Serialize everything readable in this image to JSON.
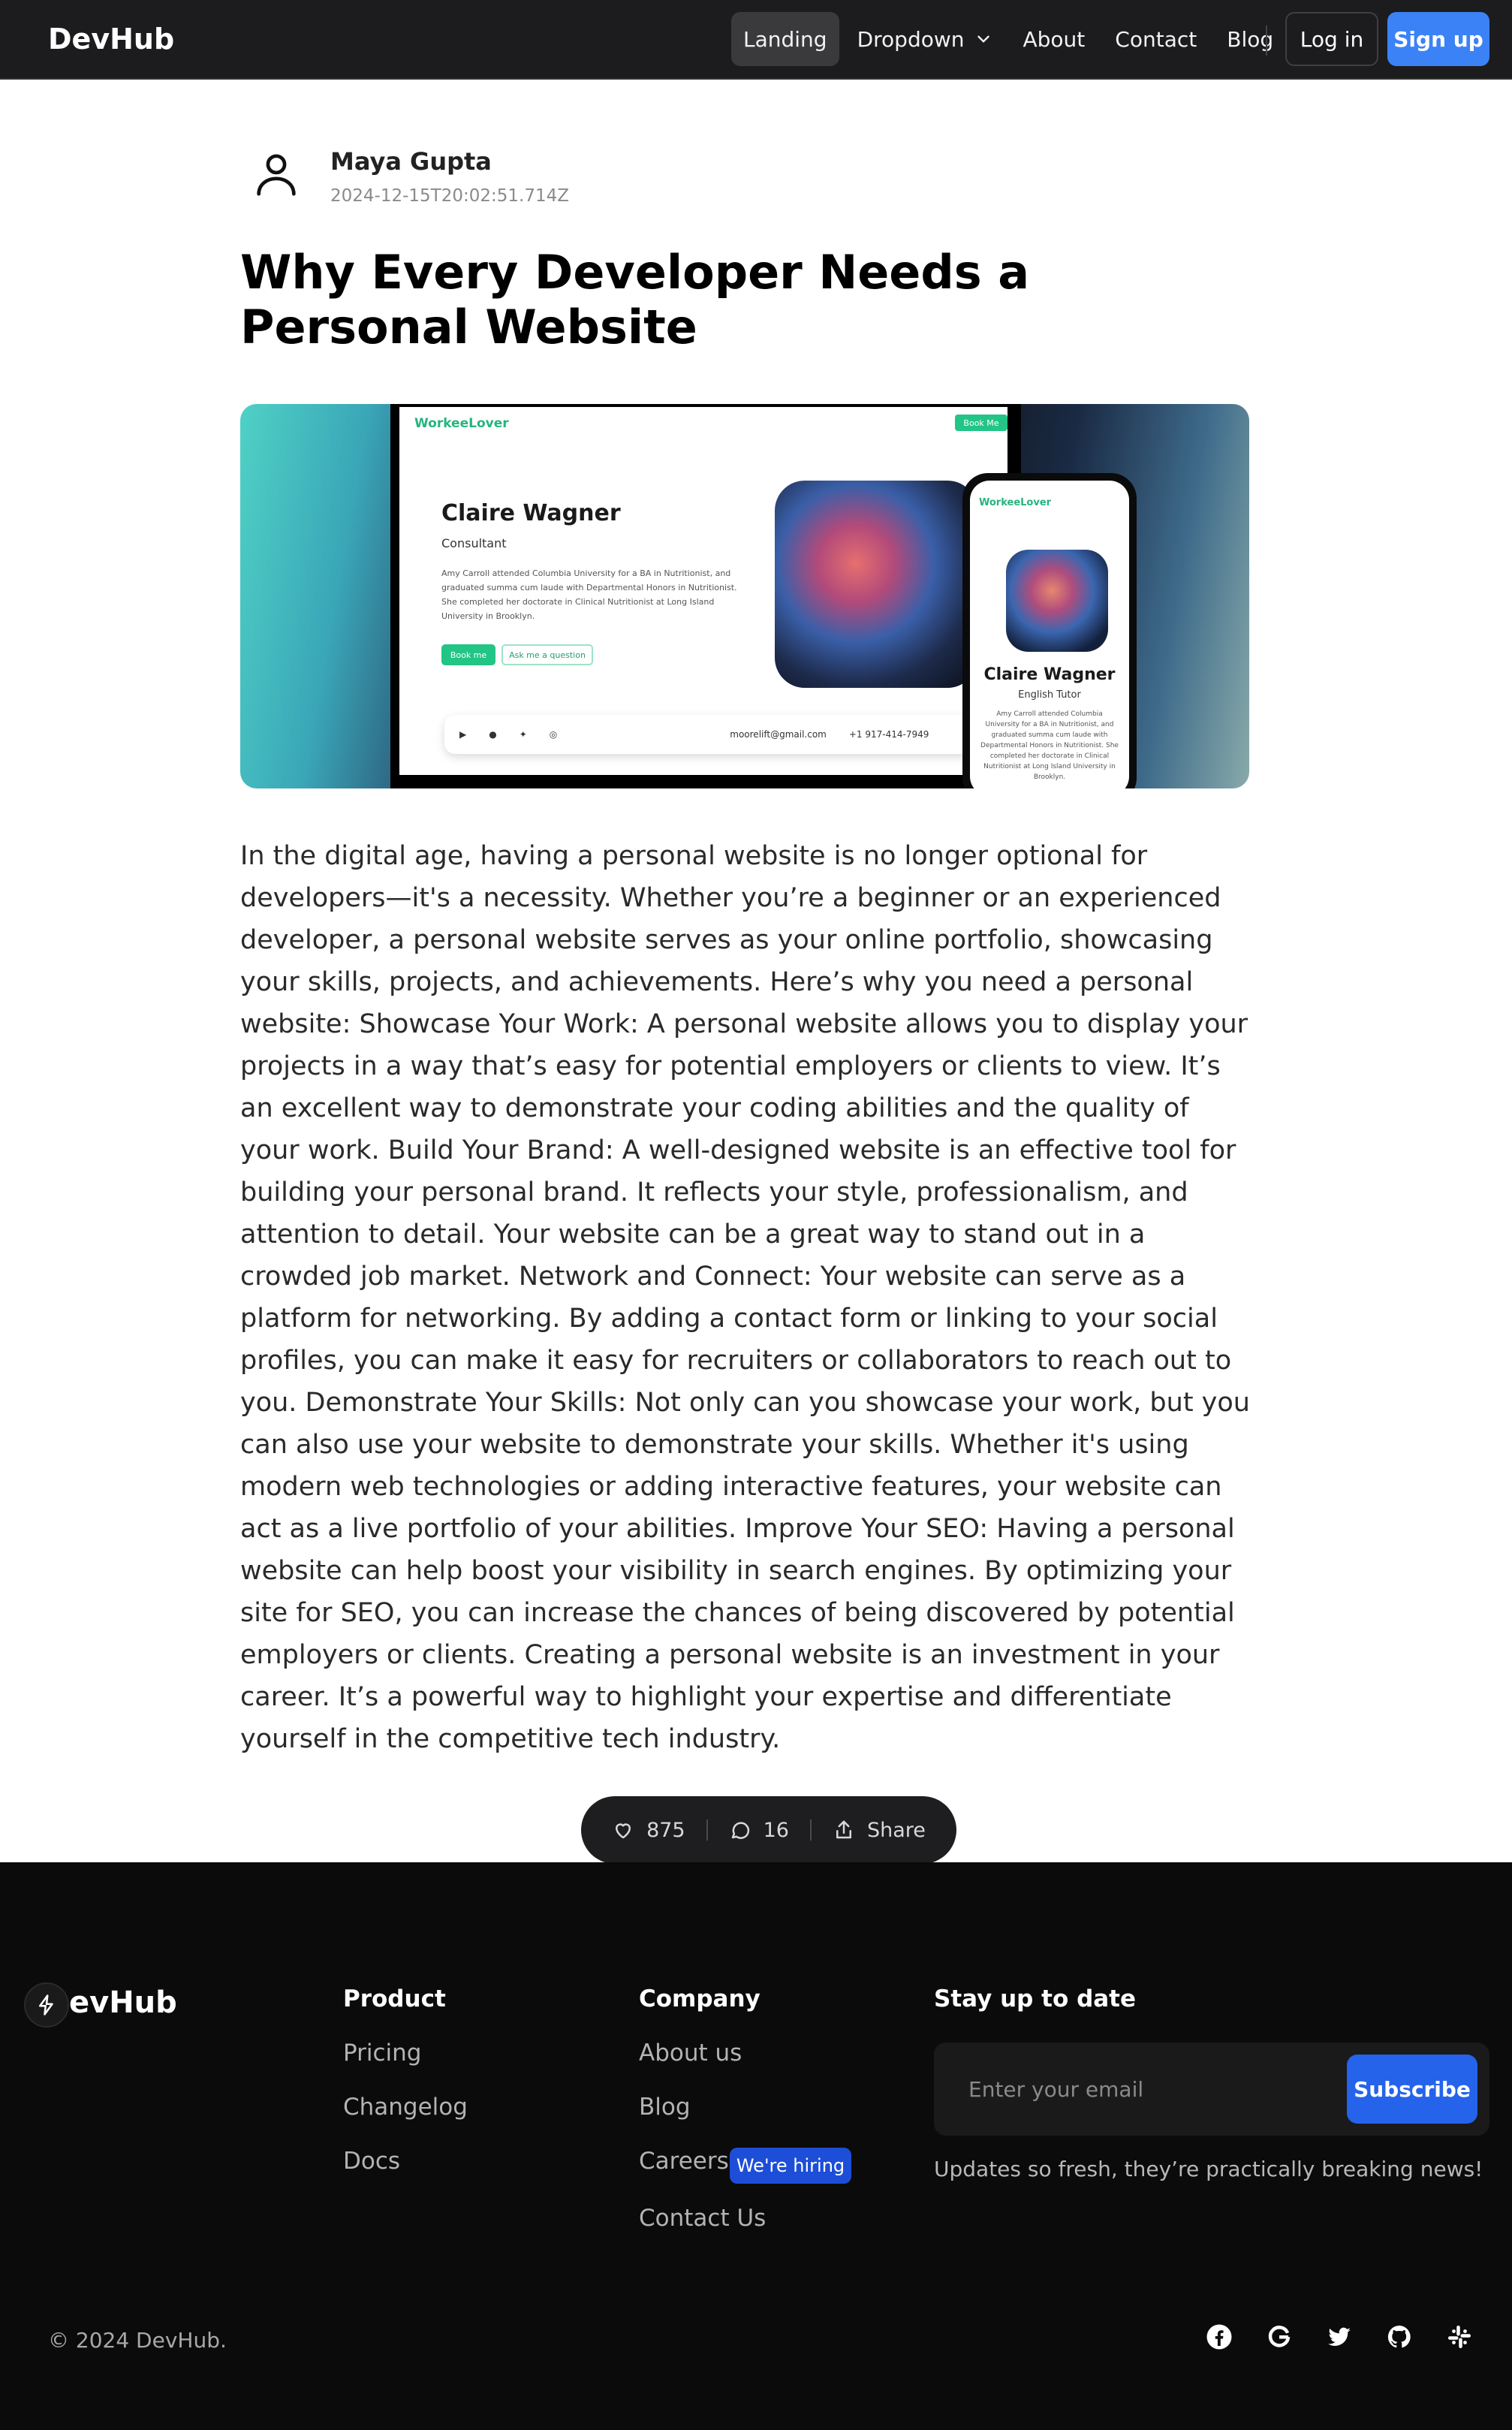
{
  "nav": {
    "brand": "DevHub",
    "links": [
      "Landing",
      "Dropdown",
      "About",
      "Contact",
      "Blog"
    ],
    "login": "Log in",
    "signup": "Sign up"
  },
  "post": {
    "author": "Maya Gupta",
    "date": "2024-12-15T20:02:51.714Z",
    "title": "Why Every Developer Needs a Personal Website",
    "hero": {
      "logo": "WorkeeLover",
      "book_me": "Book Me",
      "name": "Claire Wagner",
      "role": "Consultant",
      "bio": "Amy Carroll attended Columbia University for a BA in Nutritionist, and graduated summa cum laude with Departmental Honors in Nutritionist. She completed her doctorate in Clinical Nutritionist at Long Island University in Brooklyn.",
      "btn_book": "Book me",
      "btn_ask": "Ask me a question",
      "email": "moorelift@gmail.com",
      "phone": "+1 917-414-7949",
      "phone_name": "Claire Wagner",
      "phone_role": "English Tutor",
      "phone_bio": "Amy Carroll attended Columbia University for a BA in Nutritionist, and graduated summa cum laude with Departmental Honors in Nutritionist. She completed her doctorate in Clinical Nutritionist at Long Island University in Brooklyn."
    },
    "body": "In the digital age, having a personal website is no longer optional for developers—it's a necessity. Whether you’re a beginner or an experienced developer, a personal website serves as your online portfolio, showcasing your skills, projects, and achievements. Here’s why you need a personal website: Showcase Your Work: A personal website allows you to display your projects in a way that’s easy for potential employers or clients to view. It’s an excellent way to demonstrate your coding abilities and the quality of your work. Build Your Brand: A well-designed website is an effective tool for building your personal brand. It reflects your style, professionalism, and attention to detail. Your website can be a great way to stand out in a crowded job market. Network and Connect: Your website can serve as a platform for networking. By adding a contact form or linking to your social profiles, you can make it easy for recruiters or collaborators to reach out to you. Demonstrate Your Skills: Not only can you showcase your work, but you can also use your website to demonstrate your skills. Whether it's using modern web technologies or adding interactive features, your website can act as a live portfolio of your abilities. Improve Your SEO: Having a personal website can help boost your visibility in search engines. By optimizing your site for SEO, you can increase the chances of being discovered by potential employers or clients. Creating a personal website is an investment in your career. It’s a powerful way to highlight your expertise and differentiate yourself in the competitive tech industry."
  },
  "actions": {
    "likes": "875",
    "comments": "16",
    "share": "Share"
  },
  "footer": {
    "brand": "evHub",
    "product": {
      "title": "Product",
      "links": [
        "Pricing",
        "Changelog",
        "Docs"
      ]
    },
    "company": {
      "title": "Company",
      "links": [
        "About us",
        "Blog",
        "Careers",
        "Contact Us"
      ],
      "badge": "We're hiring"
    },
    "newsletter": {
      "title": "Stay up to date",
      "placeholder": "Enter your email",
      "button": "Subscribe",
      "note": "Updates so fresh, they’re practically breaking news!"
    },
    "copyright": "© 2024 DevHub.",
    "social_icons": [
      "facebook-icon",
      "google-icon",
      "twitter-icon",
      "github-icon",
      "slack-icon"
    ]
  }
}
